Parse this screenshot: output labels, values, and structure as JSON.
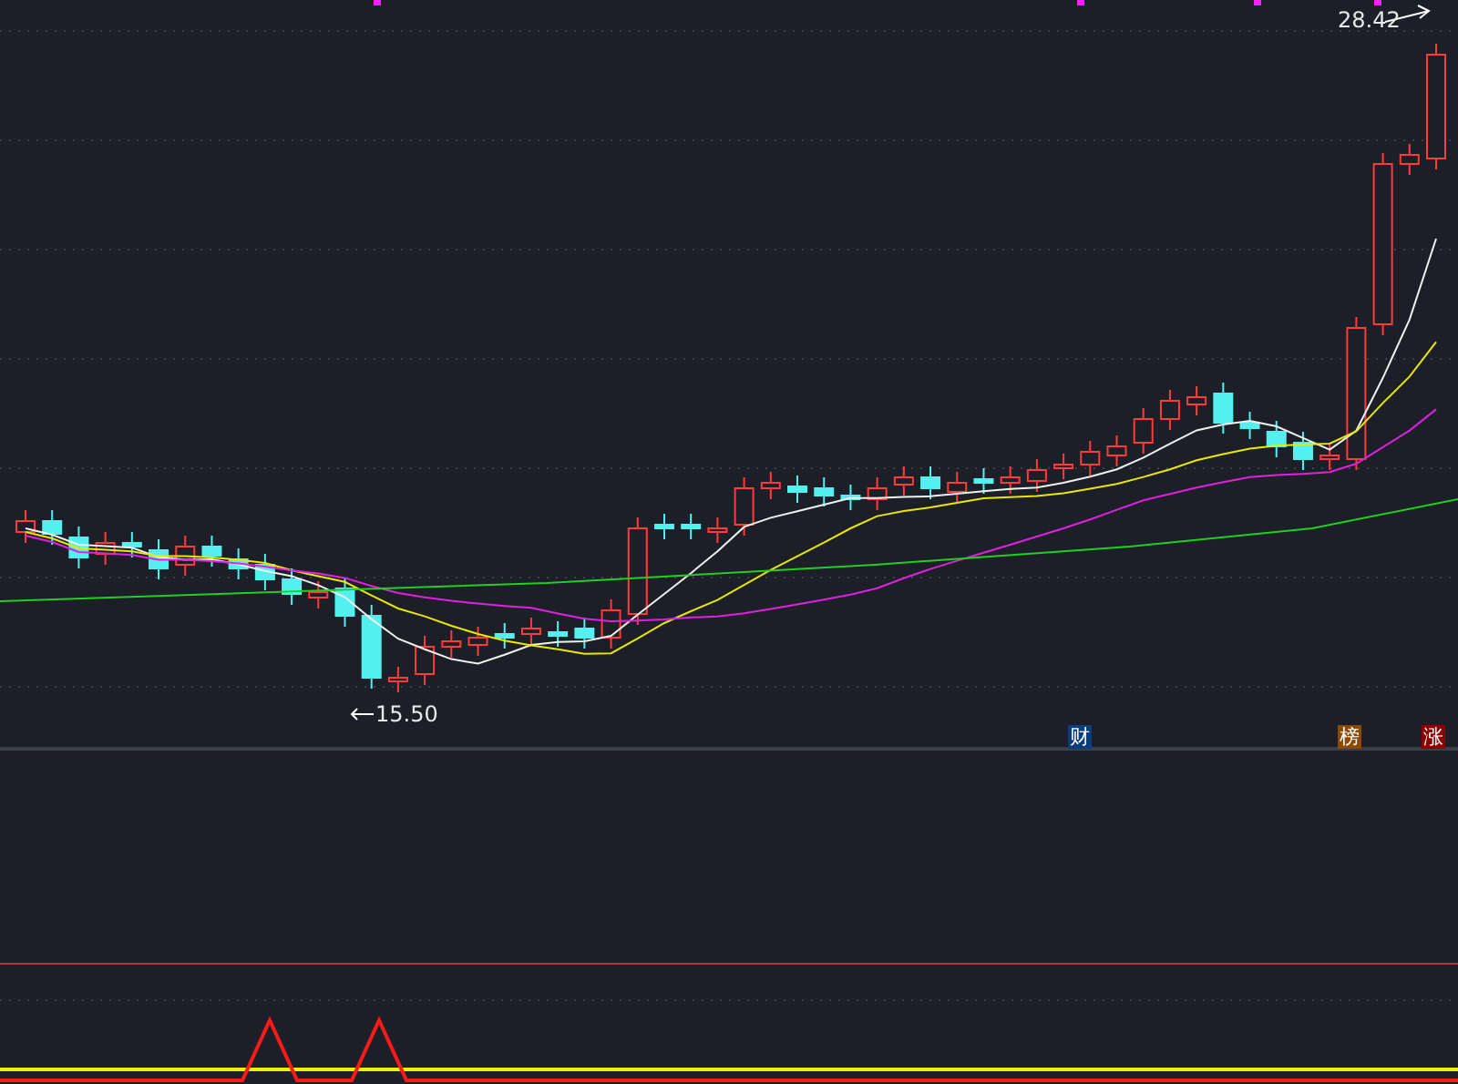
{
  "price_panel": {
    "high_label": "28.42",
    "low_label": "15.50",
    "event_markers": [
      {
        "label": "财",
        "color": "#0b3d7a"
      },
      {
        "label": "榜",
        "color": "#8c4a00"
      },
      {
        "label": "涨",
        "color": "#8a0000"
      }
    ]
  }
}
